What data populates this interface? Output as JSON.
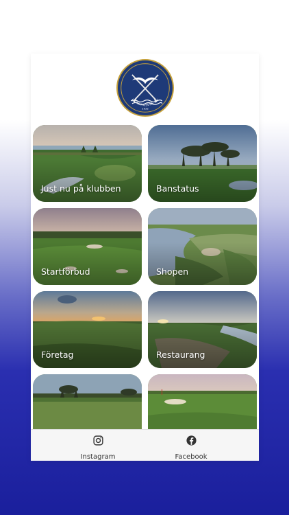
{
  "club": {
    "logo_text": "LJUNGHUSENS GK",
    "logo_year": "1932"
  },
  "tiles": [
    {
      "label": "Just nu på klubben"
    },
    {
      "label": "Banstatus"
    },
    {
      "label": "Startförbud"
    },
    {
      "label": "Shopen"
    },
    {
      "label": "Företag"
    },
    {
      "label": "Restaurang"
    },
    {
      "label": ""
    },
    {
      "label": ""
    }
  ],
  "tab_bar": {
    "instagram_label": "Instagram",
    "facebook_label": "Facebook"
  },
  "colors": {
    "brand_navy": "#1e3a78",
    "brand_gold": "#c6a13a",
    "background_blue": "#1a1f9c"
  }
}
